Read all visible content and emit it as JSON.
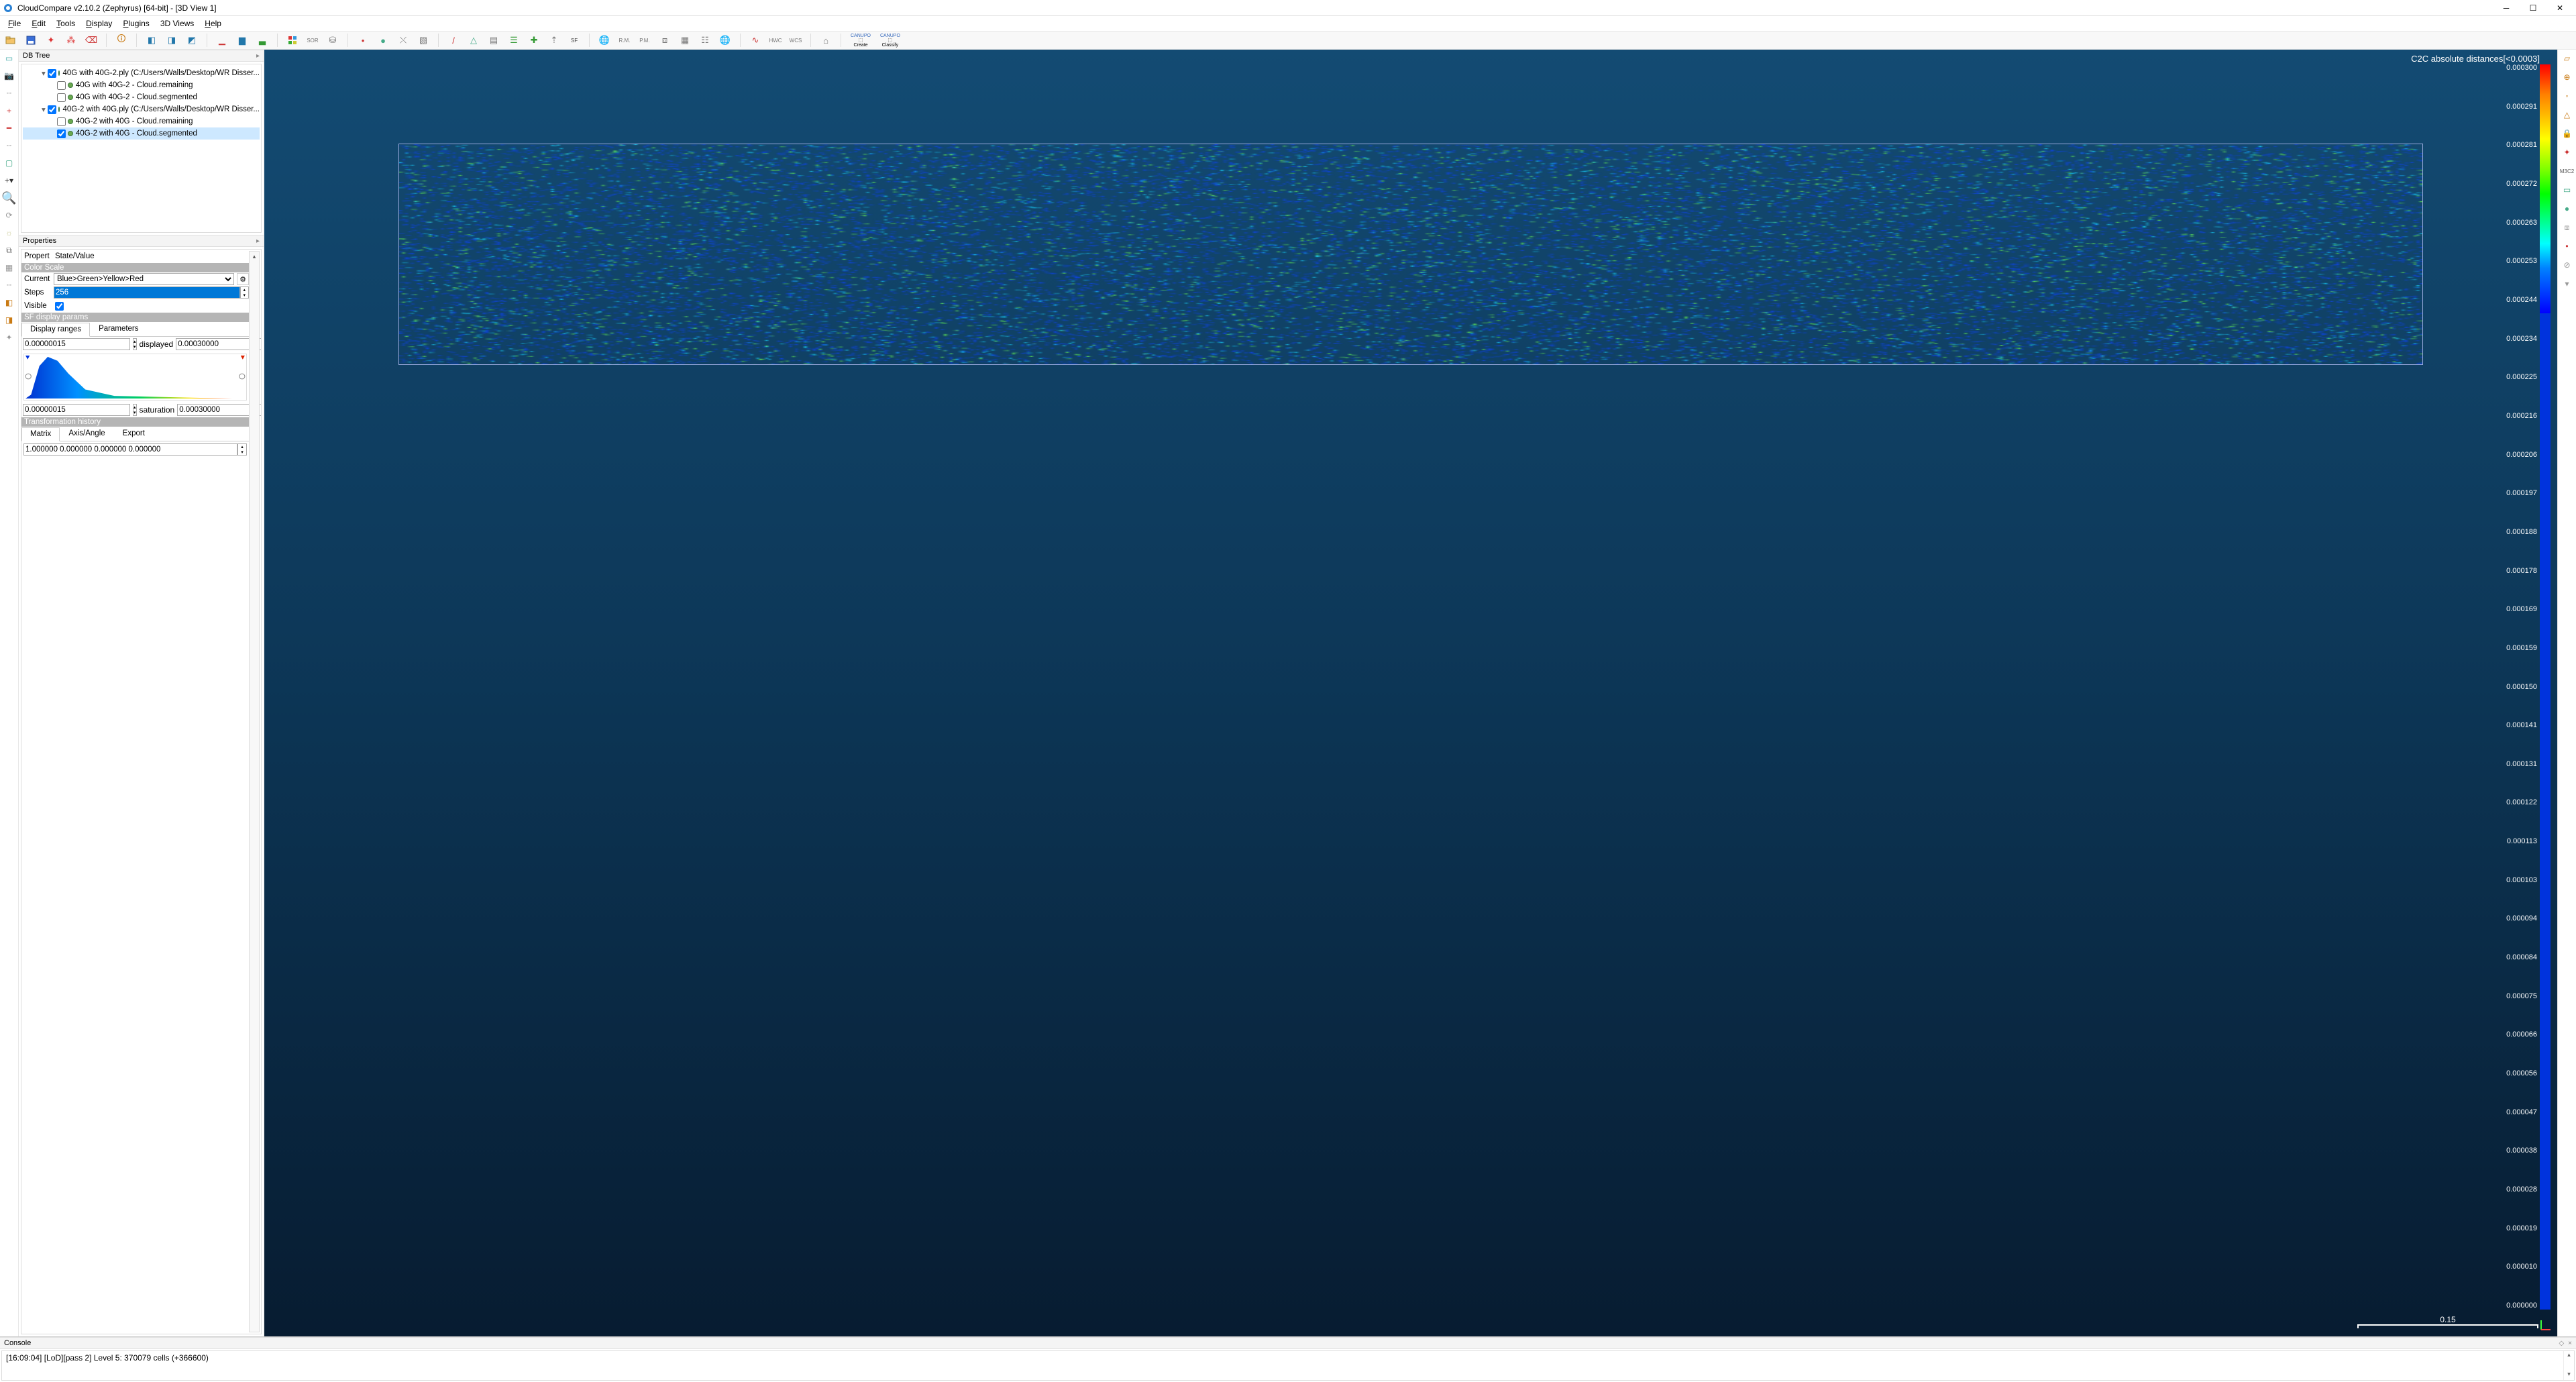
{
  "window": {
    "title": "CloudCompare v2.10.2 (Zephyrus) [64-bit] - [3D View 1]"
  },
  "menu": {
    "file": "File",
    "edit": "Edit",
    "tools": "Tools",
    "display": "Display",
    "plugins": "Plugins",
    "views": "3D Views",
    "help": "Help"
  },
  "dbtree": {
    "title": "DB Tree",
    "items": [
      {
        "label": "40G with 40G-2.ply (C:/Users/Walls/Desktop/WR Disser...",
        "checked": true,
        "indent": 1,
        "expand": true
      },
      {
        "label": "40G with 40G-2 - Cloud.remaining",
        "checked": false,
        "indent": 2
      },
      {
        "label": "40G with 40G-2 - Cloud.segmented",
        "checked": false,
        "indent": 2
      },
      {
        "label": "40G-2 with 40G.ply (C:/Users/Walls/Desktop/WR Disser...",
        "checked": true,
        "indent": 1,
        "expand": true
      },
      {
        "label": "40G-2 with 40G - Cloud.remaining",
        "checked": false,
        "indent": 2
      },
      {
        "label": "40G-2 with 40G - Cloud.segmented",
        "checked": true,
        "indent": 2,
        "selected": true
      }
    ]
  },
  "properties": {
    "title": "Properties",
    "header_prop": "Propert",
    "header_state": "State/Value",
    "color_scale": {
      "section": "Color Scale",
      "current_label": "Current",
      "current_value": "Blue>Green>Yellow>Red",
      "steps_label": "Steps",
      "steps_value": "256",
      "visible_label": "Visible",
      "visible_checked": true
    },
    "sf_display": {
      "section": "SF display params",
      "tab_ranges": "Display ranges",
      "tab_params": "Parameters",
      "min_display": "0.00000015",
      "displayed_label": "displayed",
      "max_display": "0.00030000",
      "min_sat": "0.00000015",
      "saturation_label": "saturation",
      "max_sat": "0.00030000"
    },
    "transform": {
      "section": "Transformation history",
      "tab_matrix": "Matrix",
      "tab_axis": "Axis/Angle",
      "tab_export": "Export",
      "row0": "1.000000 0.000000 0.000000 0.000000"
    }
  },
  "viewport": {
    "sf_title": "C2C absolute distances[<0.0003]",
    "scale_labels": [
      "0.000300",
      "0.000291",
      "0.000281",
      "0.000272",
      "0.000263",
      "0.000253",
      "0.000244",
      "0.000234",
      "0.000225",
      "0.000216",
      "0.000206",
      "0.000197",
      "0.000188",
      "0.000178",
      "0.000169",
      "0.000159",
      "0.000150",
      "0.000141",
      "0.000131",
      "0.000122",
      "0.000113",
      "0.000103",
      "0.000094",
      "0.000084",
      "0.000075",
      "0.000066",
      "0.000056",
      "0.000047",
      "0.000038",
      "0.000028",
      "0.000019",
      "0.000010",
      "0.000000"
    ],
    "scalebar_value": "0.15"
  },
  "console": {
    "title": "Console",
    "line": "[16:09:04] [LoD][pass 2] Level 5: 370079 cells (+366600)"
  },
  "toolbar_labels": {
    "sor": "SOR",
    "rm": "R.M.",
    "pm": "P.M.",
    "hwc": "HWC",
    "wcs": "WCS"
  },
  "canupo": {
    "create": "Create",
    "classify": "Classify",
    "top": "CANUPO"
  }
}
